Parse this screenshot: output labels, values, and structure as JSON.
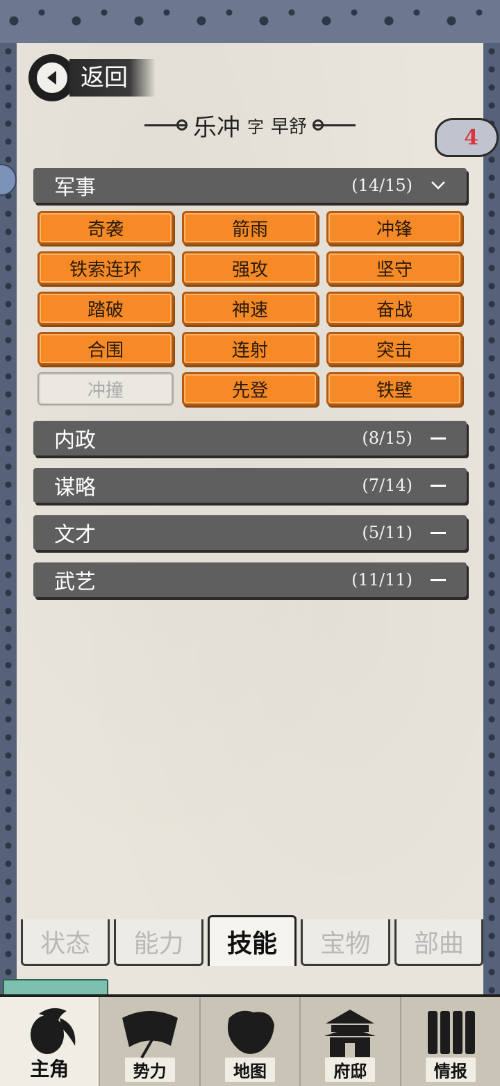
{
  "header": {
    "back_label": "返回",
    "name": "乐冲",
    "zi_label": "字",
    "style_name": "早舒",
    "badge_count": "4"
  },
  "categories": [
    {
      "name": "军事",
      "count": "(14/15)",
      "expanded": true
    },
    {
      "name": "内政",
      "count": "(8/15)",
      "expanded": false
    },
    {
      "name": "谋略",
      "count": "(7/14)",
      "expanded": false
    },
    {
      "name": "文才",
      "count": "(5/11)",
      "expanded": false
    },
    {
      "name": "武艺",
      "count": "(11/11)",
      "expanded": false
    }
  ],
  "military_skills": [
    {
      "label": "奇袭",
      "unlocked": true
    },
    {
      "label": "箭雨",
      "unlocked": true
    },
    {
      "label": "冲锋",
      "unlocked": true
    },
    {
      "label": "铁索连环",
      "unlocked": true
    },
    {
      "label": "强攻",
      "unlocked": true
    },
    {
      "label": "坚守",
      "unlocked": true
    },
    {
      "label": "踏破",
      "unlocked": true
    },
    {
      "label": "神速",
      "unlocked": true
    },
    {
      "label": "奋战",
      "unlocked": true
    },
    {
      "label": "合围",
      "unlocked": true
    },
    {
      "label": "连射",
      "unlocked": true
    },
    {
      "label": "突击",
      "unlocked": true
    },
    {
      "label": "冲撞",
      "unlocked": false
    },
    {
      "label": "先登",
      "unlocked": true
    },
    {
      "label": "铁壁",
      "unlocked": true
    }
  ],
  "subtabs": [
    {
      "label": "状态",
      "active": false
    },
    {
      "label": "能力",
      "active": false
    },
    {
      "label": "技能",
      "active": true
    },
    {
      "label": "宝物",
      "active": false
    },
    {
      "label": "部曲",
      "active": false
    }
  ],
  "bottom_nav": [
    {
      "label": "主角",
      "icon": "hero-icon",
      "active": true
    },
    {
      "label": "势力",
      "icon": "flag-icon",
      "active": false
    },
    {
      "label": "地图",
      "icon": "map-icon",
      "active": false
    },
    {
      "label": "府邸",
      "icon": "mansion-icon",
      "active": false
    },
    {
      "label": "情报",
      "icon": "scroll-icon",
      "active": false
    }
  ],
  "colors": {
    "skill_orange": "#f58a26",
    "header_gray": "#5f5f5f",
    "paper": "#e9e5dc",
    "badge_red": "#d9363e"
  }
}
